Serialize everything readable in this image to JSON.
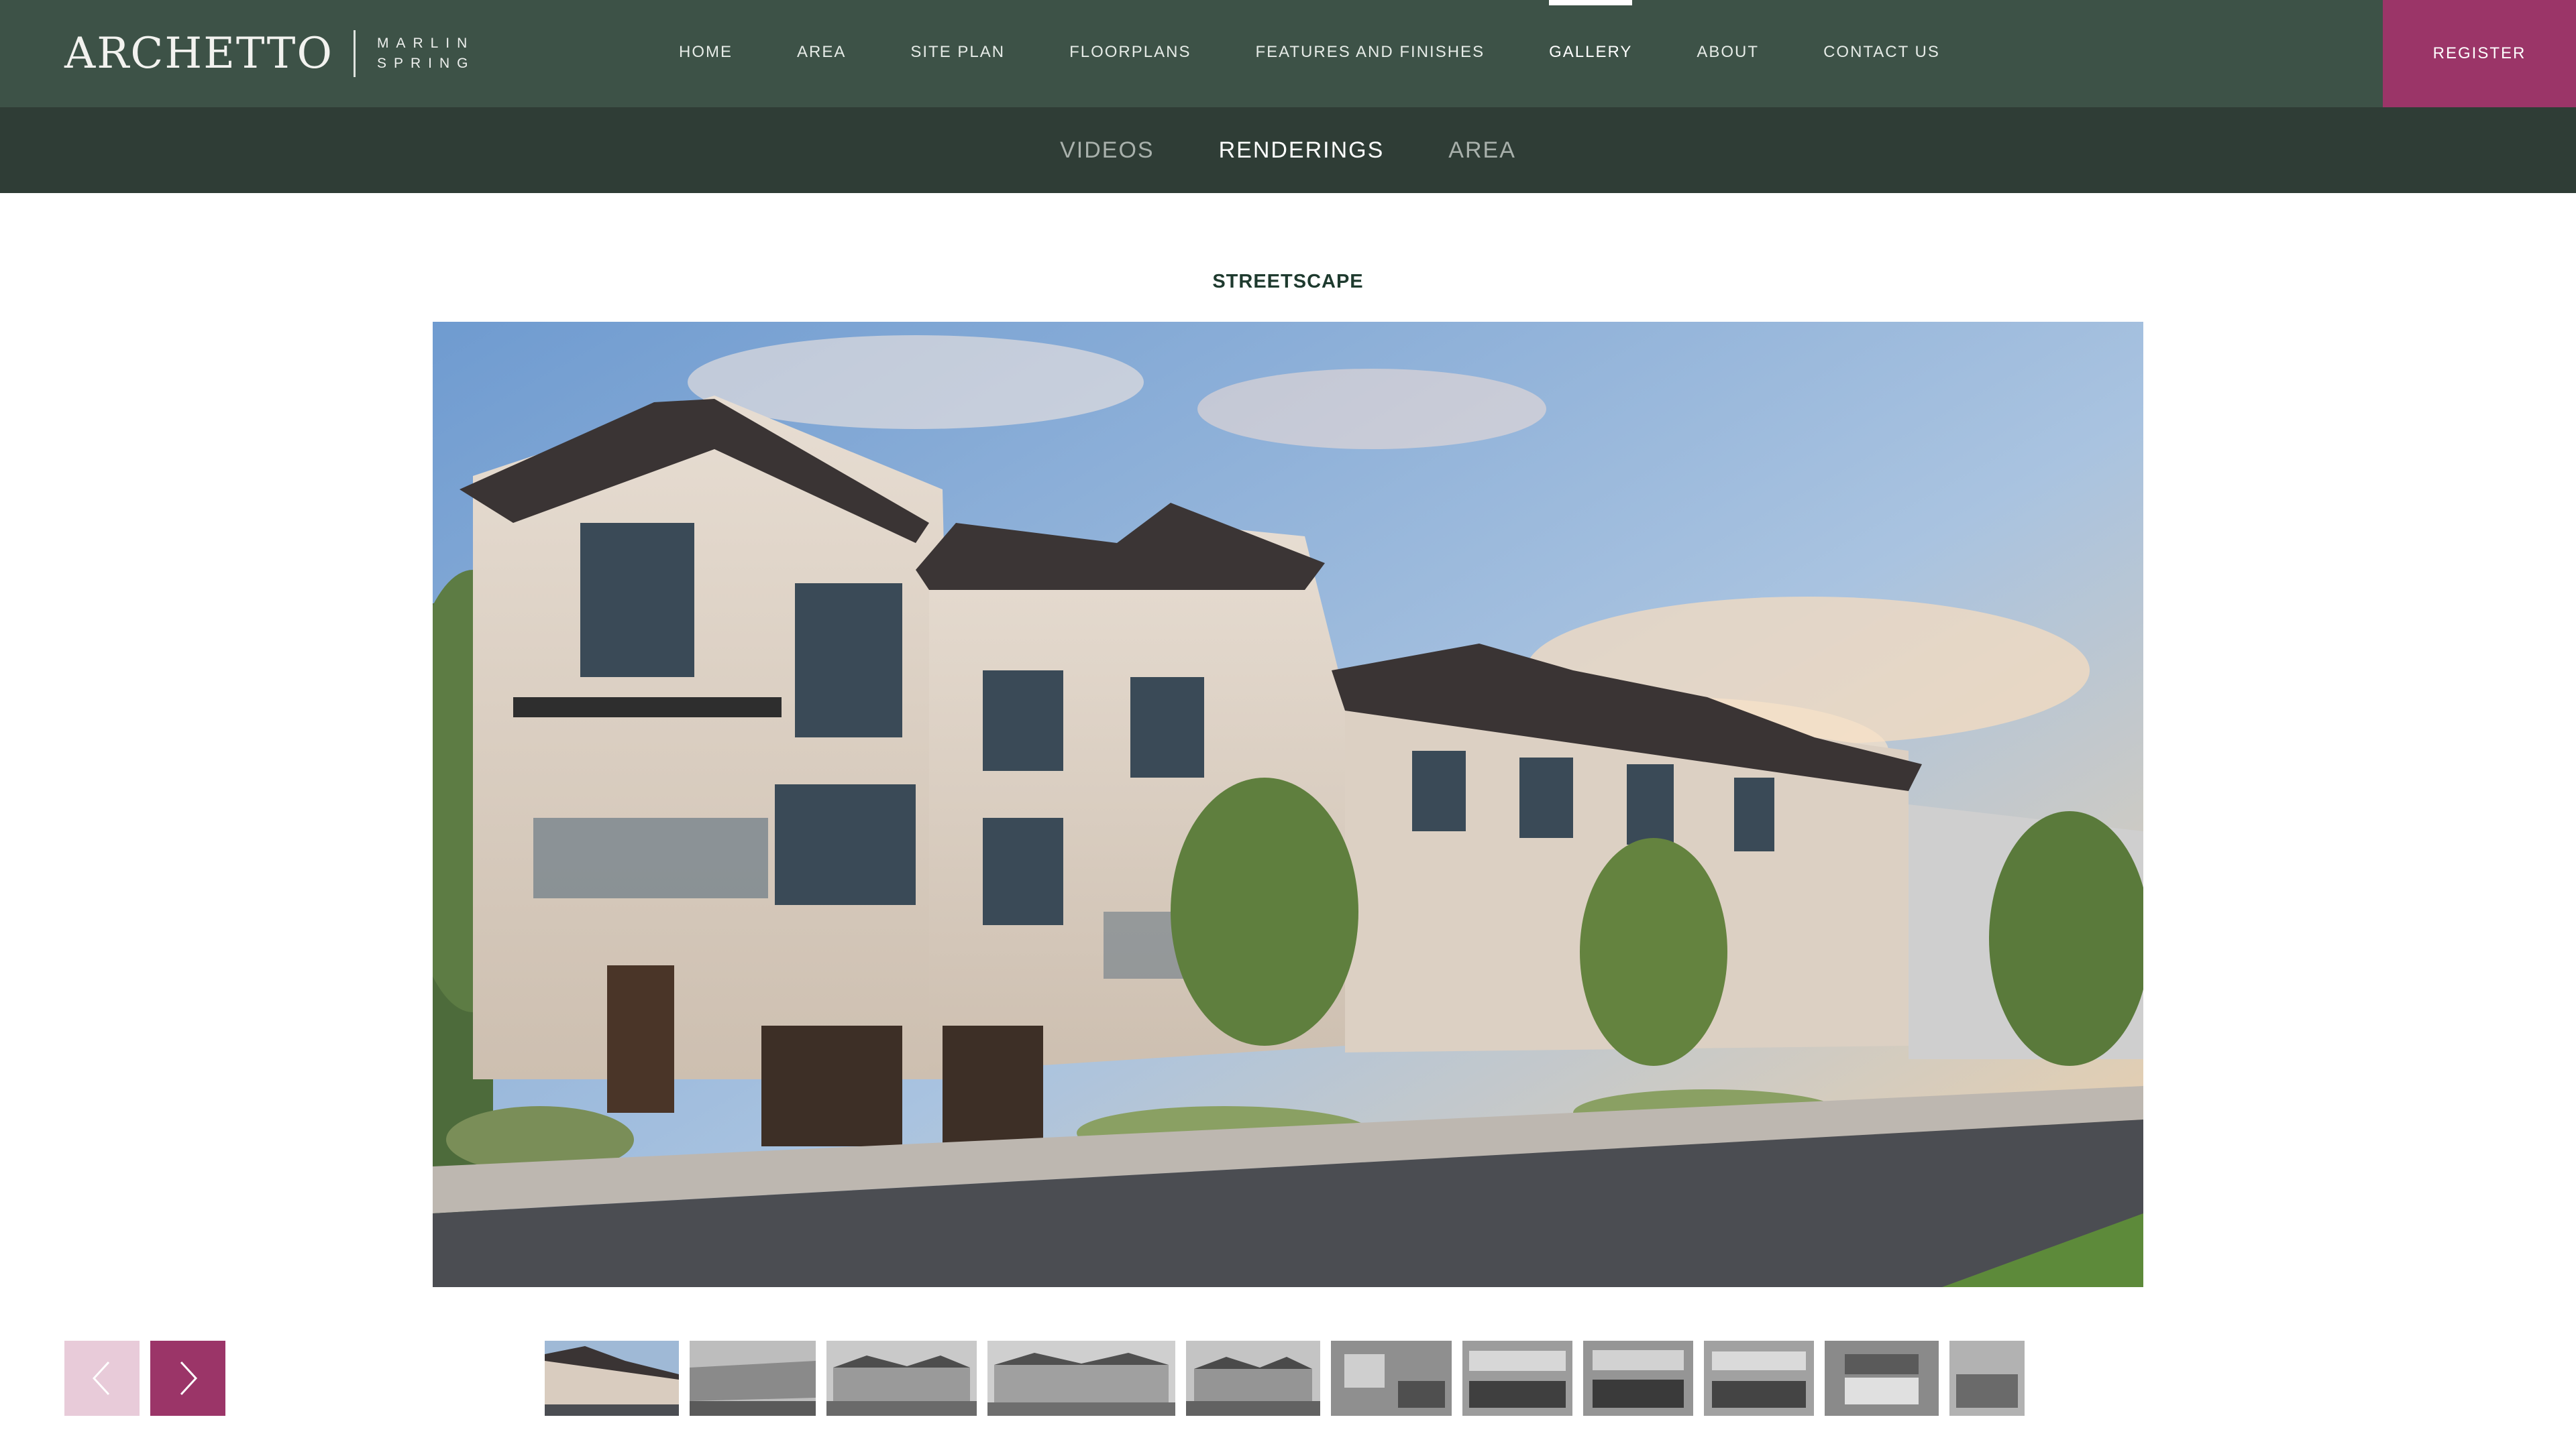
{
  "brand": {
    "name": "ARCHETTO",
    "sub_line1": "MARLIN",
    "sub_line2": "SPRING"
  },
  "nav": {
    "items": [
      {
        "label": "HOME"
      },
      {
        "label": "AREA"
      },
      {
        "label": "SITE PLAN"
      },
      {
        "label": "FLOORPLANS"
      },
      {
        "label": "FEATURES AND FINISHES"
      },
      {
        "label": "GALLERY",
        "active": true
      },
      {
        "label": "ABOUT"
      },
      {
        "label": "CONTACT US"
      }
    ],
    "register_label": "REGISTER"
  },
  "gallery_tabs": {
    "items": [
      {
        "label": "VIDEOS"
      },
      {
        "label": "RENDERINGS",
        "active": true
      },
      {
        "label": "AREA"
      }
    ]
  },
  "slide": {
    "title": "STREETSCAPE"
  },
  "controls": {
    "prev_icon": "chevron-left-icon",
    "next_icon": "chevron-right-icon"
  },
  "thumbnails": {
    "count": 11,
    "active_index": 0
  },
  "colors": {
    "nav_bg": "#3d5247",
    "subnav_bg": "#2f3d36",
    "accent": "#9b3568",
    "accent_light": "#e8cbd9"
  }
}
